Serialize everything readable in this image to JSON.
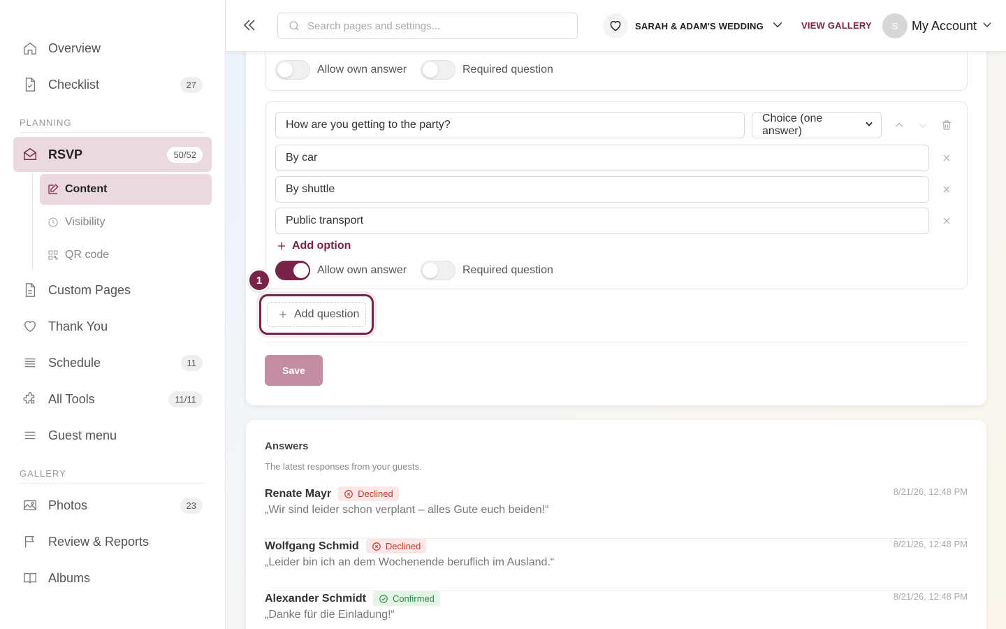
{
  "colors": {
    "accent": "#7a2348",
    "active_bg": "#ead9de",
    "declined": "#c0392b",
    "confirmed": "#2e8b45"
  },
  "sidebar": {
    "top_items": [
      {
        "label": "Overview",
        "icon": "home-icon"
      },
      {
        "label": "Checklist",
        "icon": "checklist-icon",
        "badge": "27"
      }
    ],
    "planning_label": "PLANNING",
    "rsvp": {
      "label": "RSVP",
      "badge": "50/52",
      "icon": "envelope-icon"
    },
    "rsvp_sub": [
      {
        "label": "Content",
        "icon": "edit-icon",
        "active": true
      },
      {
        "label": "Visibility",
        "icon": "clock-icon"
      },
      {
        "label": "QR code",
        "icon": "qr-code-icon"
      }
    ],
    "planning_items": [
      {
        "label": "Custom Pages",
        "icon": "page-icon"
      },
      {
        "label": "Thank You",
        "icon": "heart-icon"
      },
      {
        "label": "Schedule",
        "icon": "schedule-icon",
        "badge": "11"
      },
      {
        "label": "All Tools",
        "icon": "puzzle-icon",
        "badge": "11/11"
      },
      {
        "label": "Guest menu",
        "icon": "menu-icon"
      }
    ],
    "gallery_label": "GALLERY",
    "gallery_items": [
      {
        "label": "Photos",
        "icon": "image-icon",
        "badge": "23"
      },
      {
        "label": "Review & Reports",
        "icon": "flag-icon"
      },
      {
        "label": "Albums",
        "icon": "book-icon"
      }
    ]
  },
  "topbar": {
    "search_placeholder": "Search pages and settings...",
    "event_name": "SARAH & ADAM'S WEDDING",
    "view_gallery": "VIEW GALLERY",
    "avatar_initial": "S",
    "account_label": "My Account"
  },
  "editor": {
    "prev_question": {
      "allow_own_answer": {
        "label": "Allow own answer",
        "on": false
      },
      "required": {
        "label": "Required question",
        "on": false
      }
    },
    "question": {
      "text": "How are you getting to the party?",
      "type": "Choice (one answer)",
      "options": [
        "By car",
        "By shuttle",
        "Public transport"
      ],
      "add_option_label": "Add option",
      "allow_own_answer": {
        "label": "Allow own answer",
        "on": true
      },
      "required": {
        "label": "Required question",
        "on": false
      }
    },
    "add_question_label": "Add question",
    "step_number": "1",
    "save_label": "Save"
  },
  "answers": {
    "title": "Answers",
    "subtitle": "The latest responses from your guests.",
    "items": [
      {
        "name": "Renate Mayr",
        "status": "Declined",
        "message": "„Wir sind leider schon verplant – alles Gute euch beiden!“",
        "time": "8/21/26, 12:48 PM"
      },
      {
        "name": "Wolfgang Schmid",
        "status": "Declined",
        "message": "„Leider bin ich an dem Wochenende beruflich im Ausland.“",
        "time": "8/21/26, 12:48 PM"
      },
      {
        "name": "Alexander Schmidt",
        "status": "Confirmed",
        "message": "„Danke für die Einladung!“",
        "time": "8/21/26, 12:48 PM"
      }
    ]
  }
}
